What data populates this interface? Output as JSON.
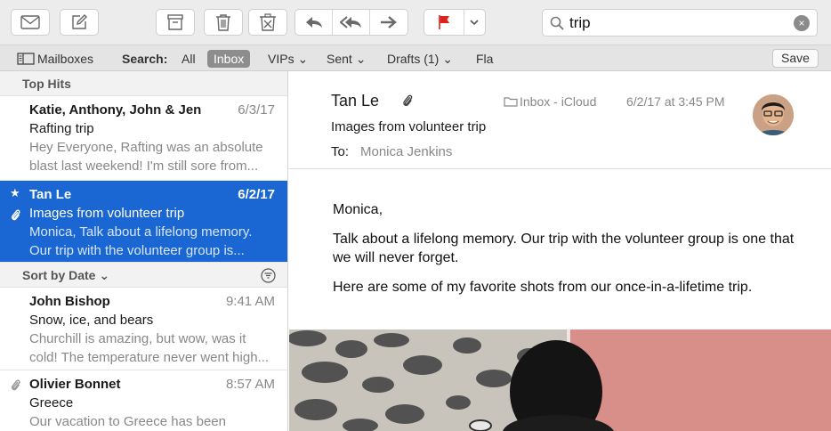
{
  "toolbar": {
    "icons": [
      "envelope-icon",
      "compose-icon",
      "archive-icon",
      "trash-icon",
      "junk-icon",
      "reply-icon",
      "reply-all-icon",
      "forward-icon",
      "flag-icon",
      "chevron-down-icon"
    ],
    "flag_color": "#e0201a"
  },
  "search": {
    "value": "trip",
    "clear_symbol": "×"
  },
  "scope": {
    "mailboxes": "Mailboxes",
    "search_label": "Search:",
    "all": "All",
    "inbox": "Inbox",
    "vips": "VIPs ⌄",
    "sent": "Sent ⌄",
    "drafts": "Drafts (1) ⌄",
    "flagged": "Fla",
    "save": "Save"
  },
  "list": {
    "top_hits_label": "Top Hits",
    "sort_label": "Sort by Date ⌄",
    "messages": [
      {
        "from": "Katie, Anthony, John & Jen",
        "date": "6/3/17",
        "subject": "Rafting trip",
        "preview": "Hey Everyone, Rafting was an absolute blast last weekend! I'm still sore from..."
      },
      {
        "from": "Tan Le",
        "date": "6/2/17",
        "subject": "Images from volunteer trip",
        "preview": "Monica, Talk about a lifelong memory. Our trip with the volunteer group is..."
      },
      {
        "from": "John Bishop",
        "date": "9:41 AM",
        "subject": "Snow, ice, and bears",
        "preview": "Churchill is amazing, but wow, was it cold! The temperature never went high..."
      },
      {
        "from": "Olivier Bonnet",
        "date": "8:57 AM",
        "subject": "Greece",
        "preview": "Our vacation to Greece has been"
      }
    ]
  },
  "reader": {
    "from": "Tan Le",
    "mailbox": "Inbox - iCloud",
    "date": "6/2/17 at 3:45 PM",
    "subject": "Images from volunteer trip",
    "to_label": "To:",
    "to": "Monica Jenkins",
    "greeting": "Monica,",
    "para1": "Talk about a lifelong memory. Our trip with the volunteer group is one that we will never forget.",
    "para2": "Here are some of my favorite shots from our once-in-a-lifetime trip."
  },
  "colors": {
    "selection": "#1a66d2",
    "accent": "#1a66d2"
  }
}
